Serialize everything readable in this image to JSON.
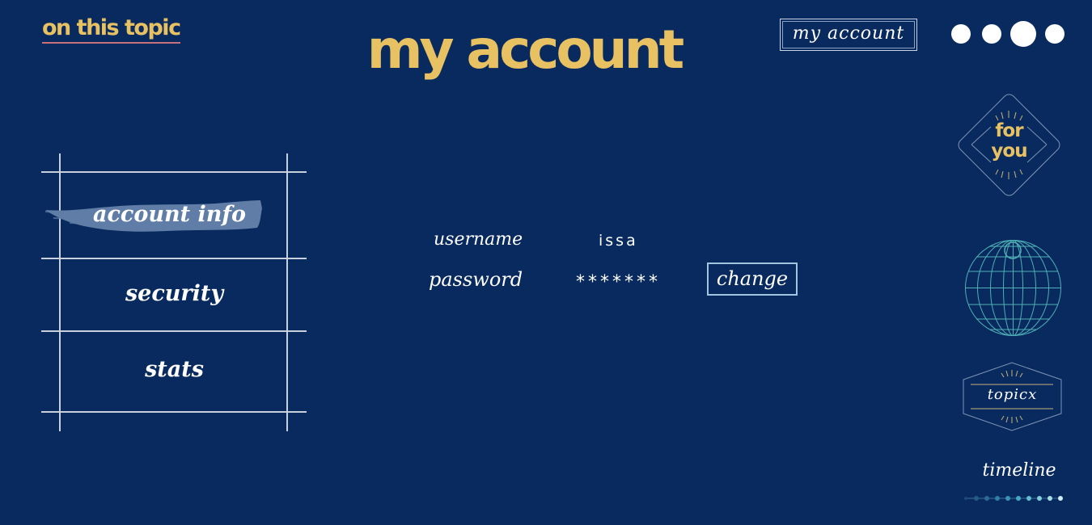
{
  "header": {
    "topic_link": "on this topic",
    "page_title": "my account",
    "account_button": "my account",
    "dots_menu": [
      "page-dot-1",
      "page-dot-2",
      "page-dot-3-active",
      "page-dot-4"
    ]
  },
  "sidebar": {
    "items": [
      {
        "label": "account info",
        "active": true
      },
      {
        "label": "security",
        "active": false
      },
      {
        "label": "stats",
        "active": false
      }
    ]
  },
  "account": {
    "username_label": "username",
    "username_value": "issa",
    "password_label": "password",
    "password_value": "*******",
    "change_label": "change"
  },
  "right_nav": {
    "for_you_line1": "for",
    "for_you_line2": "you",
    "globe_icon": "globe-icon",
    "topicx_label": "topicx",
    "timeline_label": "timeline"
  },
  "colors": {
    "background": "#082a5e",
    "accent_gold": "#e8c163",
    "link_underline": "#c9717a",
    "active_brush": "#5f7da6",
    "change_border": "#9fc6df",
    "globe": "#4fb0b6"
  }
}
